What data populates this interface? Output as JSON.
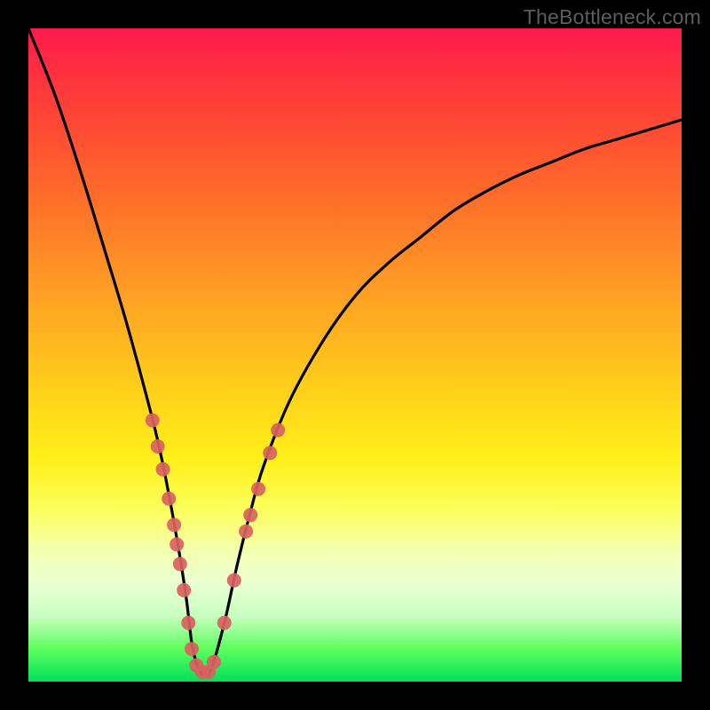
{
  "watermark": "TheBottleneck.com",
  "chart_data": {
    "type": "line",
    "title": "",
    "xlabel": "",
    "ylabel": "",
    "xlim": [
      0,
      100
    ],
    "ylim": [
      0,
      100
    ],
    "background_gradient": [
      "#ff1a4d",
      "#ffd21a",
      "#00e05a"
    ],
    "series": [
      {
        "name": "curve",
        "stroke": "#000000",
        "x": [
          0,
          4,
          8,
          12,
          15,
          18,
          20,
          22,
          24,
          25,
          26,
          27,
          28,
          30,
          32,
          34,
          36,
          40,
          45,
          50,
          55,
          60,
          65,
          70,
          75,
          80,
          85,
          90,
          95,
          100
        ],
        "values": [
          100,
          90,
          78,
          65,
          55,
          44,
          36,
          26,
          14,
          6,
          2,
          1,
          2,
          9,
          18,
          26,
          33,
          43,
          52,
          59,
          64,
          68,
          72,
          75,
          77.5,
          79.5,
          81.5,
          83,
          84.5,
          86
        ]
      }
    ],
    "markers": {
      "name": "dots",
      "color": "#d9625f",
      "radius_px": 8,
      "points": [
        {
          "x": 19.0,
          "y": 40
        },
        {
          "x": 19.8,
          "y": 36
        },
        {
          "x": 20.6,
          "y": 32.5
        },
        {
          "x": 21.5,
          "y": 28
        },
        {
          "x": 22.3,
          "y": 24
        },
        {
          "x": 22.7,
          "y": 21
        },
        {
          "x": 23.2,
          "y": 18
        },
        {
          "x": 23.8,
          "y": 14
        },
        {
          "x": 24.5,
          "y": 9
        },
        {
          "x": 25.0,
          "y": 5
        },
        {
          "x": 25.7,
          "y": 2.5
        },
        {
          "x": 26.6,
          "y": 1.5
        },
        {
          "x": 27.6,
          "y": 1.5
        },
        {
          "x": 28.4,
          "y": 3
        },
        {
          "x": 30.0,
          "y": 9
        },
        {
          "x": 31.5,
          "y": 15.5
        },
        {
          "x": 33.3,
          "y": 23
        },
        {
          "x": 34.0,
          "y": 25.5
        },
        {
          "x": 35.2,
          "y": 29.5
        },
        {
          "x": 37.0,
          "y": 35
        },
        {
          "x": 38.2,
          "y": 38.5
        }
      ]
    }
  }
}
